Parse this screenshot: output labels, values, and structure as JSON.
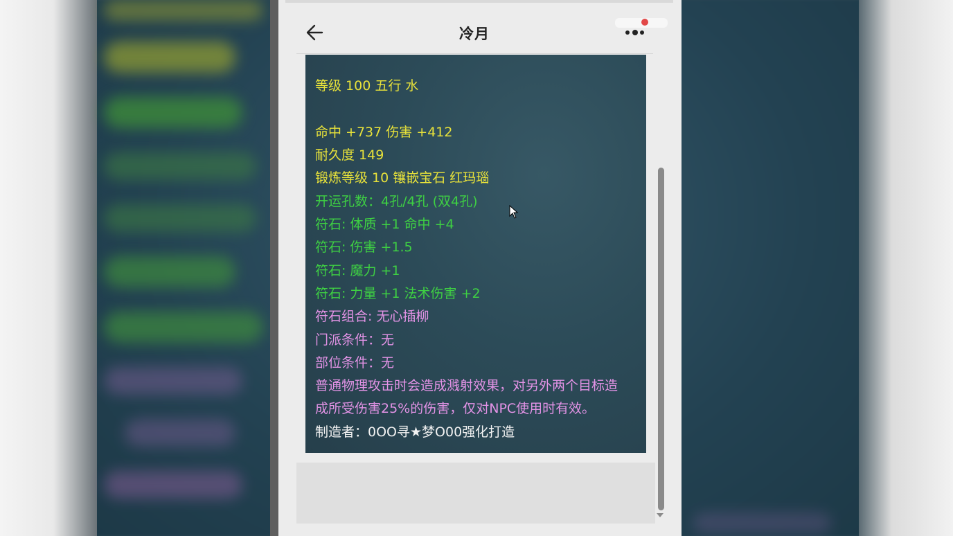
{
  "header": {
    "title": "冷月"
  },
  "item_tooltip": {
    "lines": [
      {
        "text": "等级 100 五行 水",
        "color": "yellow"
      },
      {
        "text": "命中 +737 伤害 +412",
        "color": "yellow"
      },
      {
        "text": "耐久度 149",
        "color": "yellow"
      },
      {
        "text": "锻炼等级 10 镶嵌宝石 红玛瑙",
        "color": "yellow"
      },
      {
        "text": "开运孔数：4孔/4孔 (双4孔)",
        "color": "green"
      },
      {
        "text": "符石: 体质 +1 命中 +4",
        "color": "green"
      },
      {
        "text": "符石: 伤害 +1.5",
        "color": "green"
      },
      {
        "text": "符石: 魔力 +1",
        "color": "green"
      },
      {
        "text": "符石: 力量 +1 法术伤害 +2",
        "color": "green"
      },
      {
        "text": "符石组合: 无心插柳",
        "color": "purple"
      },
      {
        "text": "门派条件：无",
        "color": "purple"
      },
      {
        "text": "部位条件：无",
        "color": "purple"
      },
      {
        "text": "普通物理攻击时会造成溅射效果，对另外两个目标造",
        "color": "purple"
      },
      {
        "text": "成所受伤害25%的伤害，仅对NPC使用时有效。",
        "color": "purple"
      },
      {
        "text": "制造者：0OO寻★梦O00强化打造",
        "color": "white"
      }
    ]
  },
  "icons": {
    "back": "arrow-left-icon",
    "more": "more-dots-icon",
    "cursor": "mouse-pointer-icon"
  },
  "colors": {
    "yellow": "#e8e23a",
    "green": "#3ed043",
    "purple": "#e393e6",
    "white": "#f2f2f2",
    "panel_bg": "#2c4b58"
  }
}
